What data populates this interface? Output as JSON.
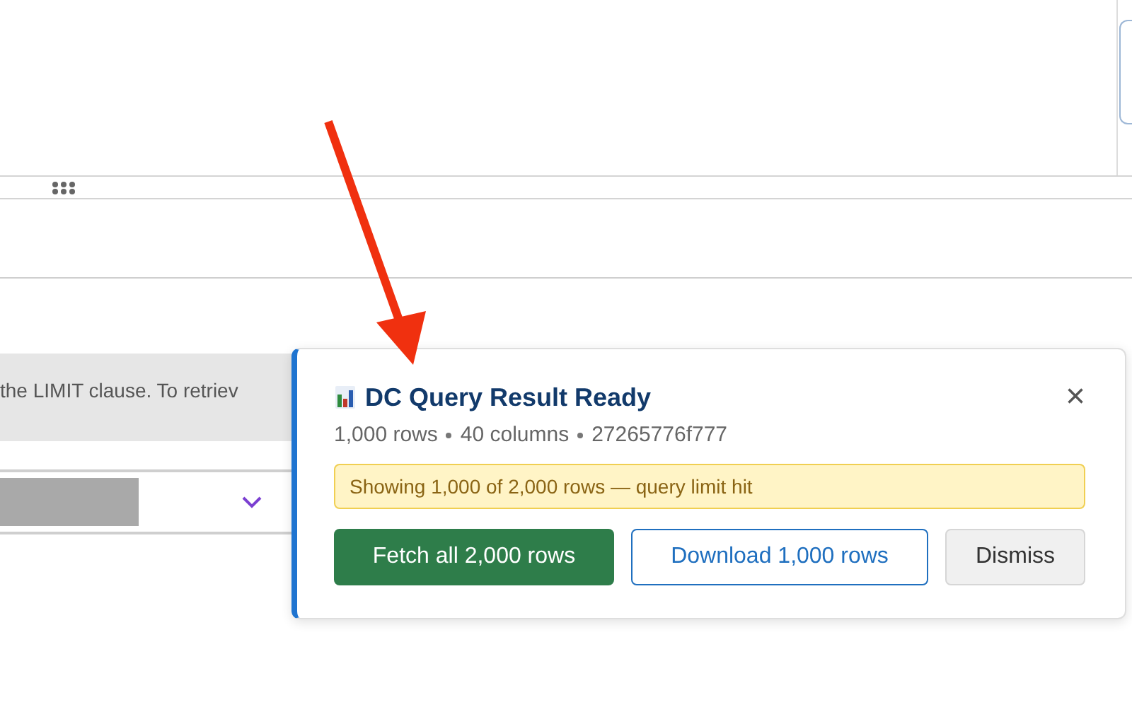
{
  "banner": {
    "text": "the LIMIT clause. To retriev"
  },
  "notification": {
    "title": "DC Query Result Ready",
    "meta": [
      "1,000 rows",
      "40 columns",
      "27265776f777"
    ],
    "warning": "Showing 1,000 of 2,000 rows — query limit hit",
    "close": "×",
    "actions": [
      {
        "label": "Fetch all 2,000 rows",
        "kind": "primary"
      },
      {
        "label": "Download 1,000 rows",
        "kind": "outline"
      },
      {
        "label": "Dismiss",
        "kind": "plain"
      }
    ]
  }
}
